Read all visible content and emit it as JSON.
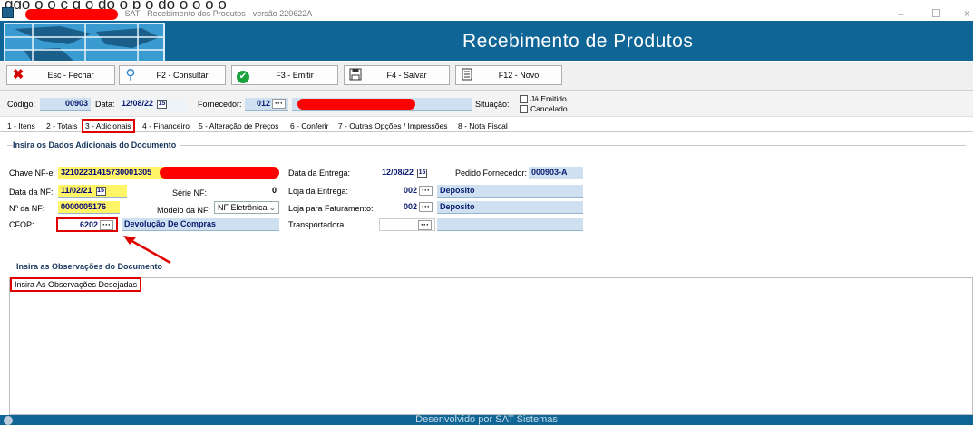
{
  "window": {
    "top_text": "ggo o  o  ç  q   o  do   o   p      o do   o   o  o  o ",
    "title": "- SAT - Recebimento dos Produtos - versão 220622A",
    "minimize": "–",
    "maximize": "☐",
    "close": "×"
  },
  "banner": {
    "title": "Recebimento de Produtos"
  },
  "toolbar": {
    "close_label": "Esc - Fechar",
    "consult_label": "F2 - Consultar",
    "emit_label": "F3 - Emitir",
    "save_label": "F4 - Salvar",
    "new_label": "F12 - Novo"
  },
  "header": {
    "codigo_label": "Código:",
    "codigo_value": "00903",
    "data_label": "Data:",
    "data_value": "12/08/22",
    "fornecedor_label": "Fornecedor:",
    "fornecedor_value": "012",
    "situacao_label": "Situação:",
    "ja_emitido_label": "Já Emitido",
    "cancelado_label": "Cancelado"
  },
  "tabs": [
    "1 - Itens",
    "2 - Totais",
    "3 - Adicionais",
    "4 - Financeiro",
    "5 - Alteração de Preços",
    "6 - Conferir",
    "7 - Outras Opções / Impressões",
    "8 - Nota Fiscal"
  ],
  "section_doc": {
    "title": "Insira os Dados Adicionais do Documento"
  },
  "form": {
    "chave_label": "Chave NF-e:",
    "chave_value": "32102231415730001305",
    "data_nf_label": "Data da NF:",
    "data_nf_value": "11/02/21",
    "serie_label": "Série NF:",
    "serie_value": "0",
    "num_nf_label": "Nº da NF:",
    "num_nf_value": "0000005176",
    "modelo_label": "Modelo da NF:",
    "modelo_value": "NF Eletrônica",
    "cfop_label": "CFOP:",
    "cfop_value": "6202",
    "cfop_desc": "Devolução De Compras",
    "data_entrega_label": "Data da Entrega:",
    "data_entrega_value": "12/08/22",
    "pedido_label": "Pedido Fornecedor:",
    "pedido_value": "000903-A",
    "loja_entrega_label": "Loja da Entrega:",
    "loja_entrega_code": "002",
    "loja_entrega_name": "Deposito",
    "loja_fat_label": "Loja para Faturamento:",
    "loja_fat_code": "002",
    "loja_fat_name": "Deposito",
    "transp_label": "Transportadora:"
  },
  "section_obs": {
    "title": "Insira as Observações do Documento"
  },
  "observacoes": {
    "value": "Insira As Observações Desejadas"
  },
  "footer": {
    "text": "Desenvolvido por SAT Sistemas"
  },
  "colors": {
    "banner": "#0f6696",
    "annotation": "#e00000",
    "highlight": "#fff566"
  }
}
